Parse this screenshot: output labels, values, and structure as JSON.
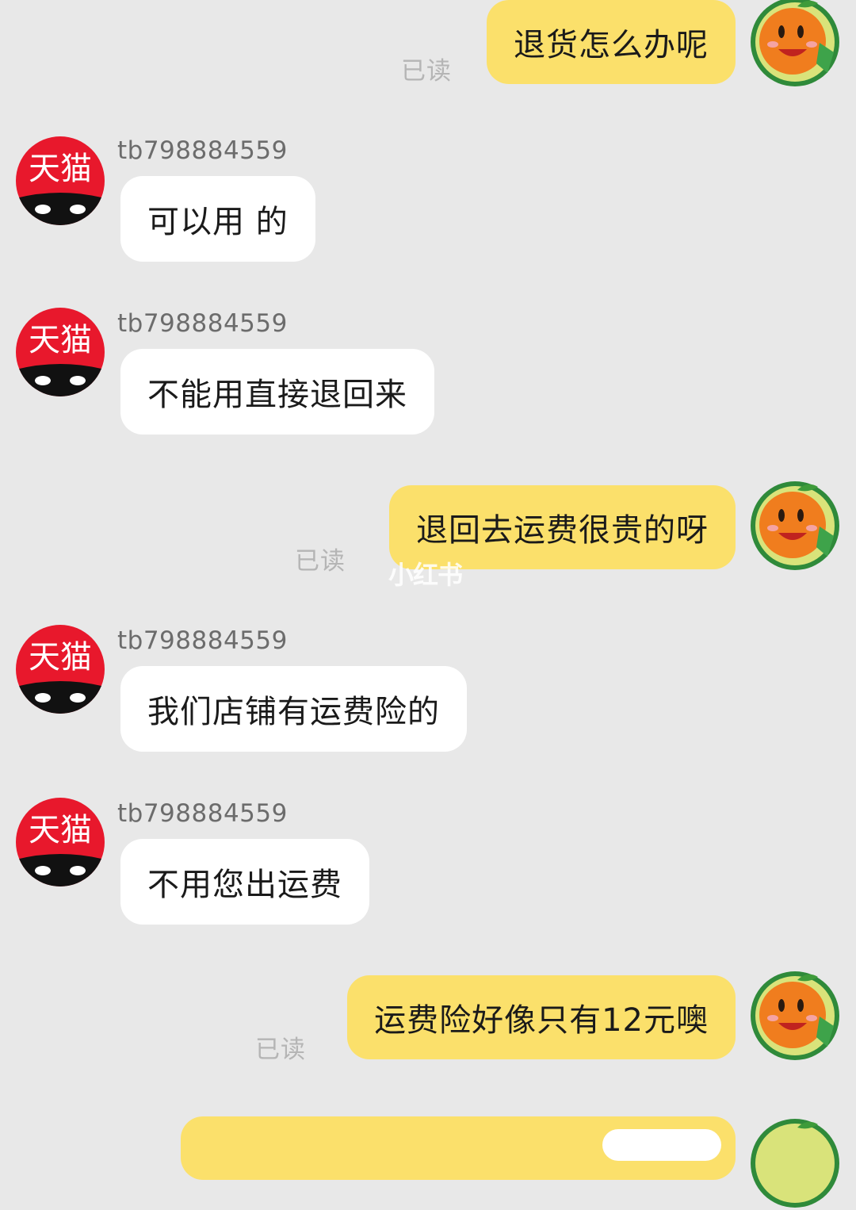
{
  "conversation": {
    "messages": [
      {
        "from": "self",
        "text": "退货怎么办呢",
        "status": "已读"
      },
      {
        "from": "shop",
        "sender": "tb798884559",
        "text": "可以用 的"
      },
      {
        "from": "shop",
        "sender": "tb798884559",
        "text": "不能用直接退回来"
      },
      {
        "from": "self",
        "text": "退回去运费很贵的呀",
        "status": "已读"
      },
      {
        "from": "shop",
        "sender": "tb798884559",
        "text": "我们店铺有运费险的"
      },
      {
        "from": "shop",
        "sender": "tb798884559",
        "text": "不用您出运费"
      },
      {
        "from": "self",
        "text": "运费险好像只有12元噢",
        "status": "已读"
      }
    ]
  },
  "shop_avatar": {
    "label": "天猫",
    "icon": "tmall-cat-avatar-icon",
    "color": "#e8182c"
  },
  "self_avatar": {
    "icon": "orange-cartoon-avatar-icon"
  },
  "watermark": {
    "text": "小红书"
  },
  "colors": {
    "background": "#e8e8e8",
    "self_bubble": "#fbe06b",
    "shop_bubble": "#ffffff",
    "read_status": "#b5b5b5",
    "brand_red": "#e8182c"
  }
}
